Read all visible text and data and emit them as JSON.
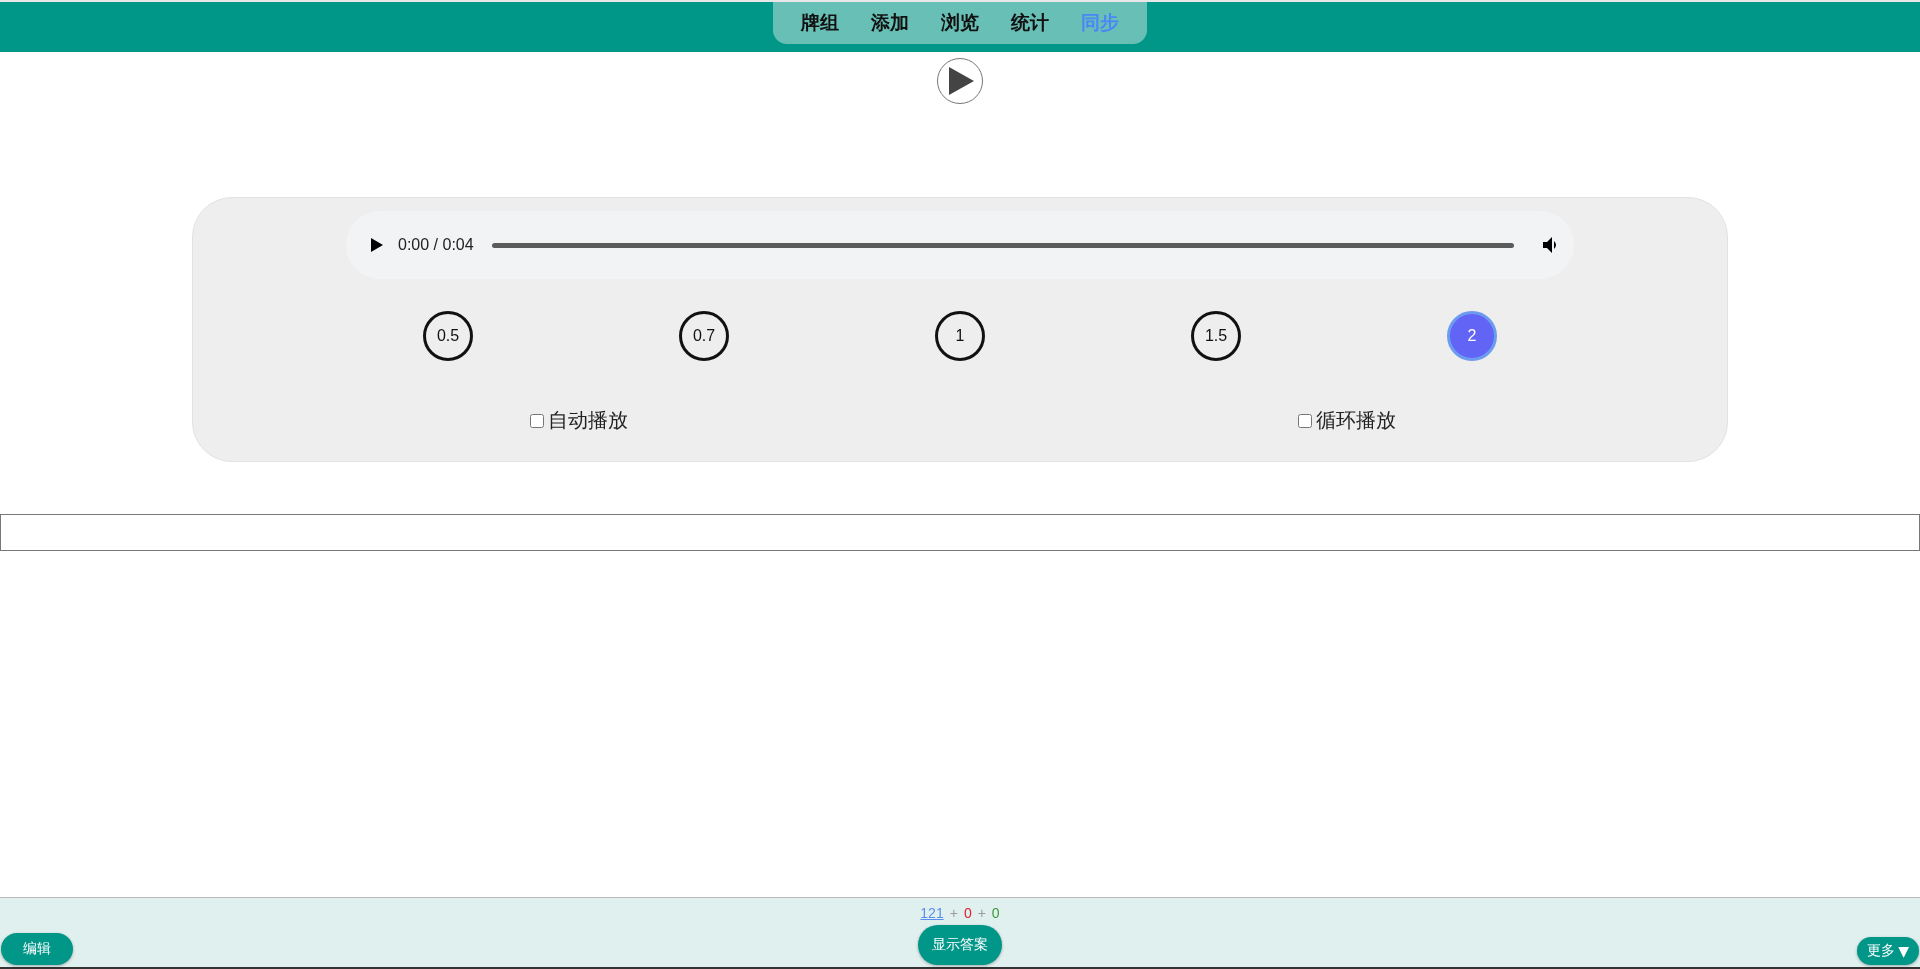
{
  "nav": {
    "tabs": [
      {
        "label": "牌组",
        "selected": false
      },
      {
        "label": "添加",
        "selected": false
      },
      {
        "label": "浏览",
        "selected": false
      },
      {
        "label": "统计",
        "selected": false
      },
      {
        "label": "同步",
        "selected": true
      }
    ]
  },
  "player": {
    "time": "0:00 / 0:04",
    "speeds": [
      {
        "label": "0.5",
        "selected": false
      },
      {
        "label": "0.7",
        "selected": false
      },
      {
        "label": "1",
        "selected": false
      },
      {
        "label": "1.5",
        "selected": false
      },
      {
        "label": "2",
        "selected": true
      }
    ],
    "options": [
      {
        "label": "自动播放",
        "checked": false
      },
      {
        "label": "循环播放",
        "checked": false
      }
    ]
  },
  "footer": {
    "counts": [
      {
        "kind": "link",
        "text": "121",
        "color": "#5b8def"
      },
      {
        "kind": "separator",
        "text": "+",
        "color": "#9a9a9a"
      },
      {
        "kind": "number",
        "text": "0",
        "color": "#e0202a"
      },
      {
        "kind": "separator",
        "text": "+",
        "color": "#9a9a9a"
      },
      {
        "kind": "number",
        "text": "0",
        "color": "#3a9a3a"
      }
    ],
    "edit_button": "编辑",
    "show_answer_button": "显示答案",
    "more_button": "更多",
    "more_caret": "▼"
  }
}
